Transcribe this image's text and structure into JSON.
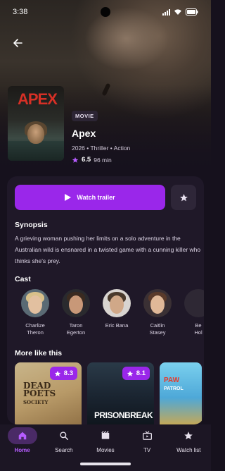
{
  "status_bar": {
    "time": "3:38"
  },
  "movie": {
    "poster_title": "APEX",
    "type_chip": "MOVIE",
    "title": "Apex",
    "subtitle": "2026 • Thriller • Action",
    "rating": "6.5",
    "runtime": "96 min"
  },
  "actions": {
    "watch_trailer_label": "Watch trailer"
  },
  "synopsis": {
    "heading": "Synopsis",
    "text": "A grieving woman pushing her limits on a solo adventure in the Australian wild is ensnared in a twisted game with a cunning killer who thinks she's prey."
  },
  "cast": {
    "heading": "Cast",
    "members": [
      {
        "first": "Charlize",
        "last": "Theron"
      },
      {
        "first": "Taron",
        "last": "Egerton"
      },
      {
        "first": "Eric Bana",
        "last": ""
      },
      {
        "first": "Caitlin",
        "last": "Stasey"
      },
      {
        "first": "Be",
        "last": "Hol"
      }
    ]
  },
  "more_like_this": {
    "heading": "More like this",
    "items": [
      {
        "poster_text_1": "DEAD",
        "poster_text_2": "POETS",
        "poster_text_3": "SOCIETY",
        "rating": "8.3"
      },
      {
        "poster_text_1": "PRISON",
        "poster_text_2": "BREAK",
        "rating": "8.1"
      },
      {
        "poster_text_1": "PAW",
        "poster_text_2": "PATROL"
      }
    ]
  },
  "nav": {
    "items": [
      {
        "label": "Home",
        "icon": "home-icon",
        "active": true
      },
      {
        "label": "Search",
        "icon": "search-icon"
      },
      {
        "label": "Movies",
        "icon": "movies-icon"
      },
      {
        "label": "TV",
        "icon": "tv-icon"
      },
      {
        "label": "Watch list",
        "icon": "star-icon"
      }
    ]
  },
  "colors": {
    "accent": "#9a27ea",
    "background": "#16111d",
    "card": "#1f1828"
  }
}
